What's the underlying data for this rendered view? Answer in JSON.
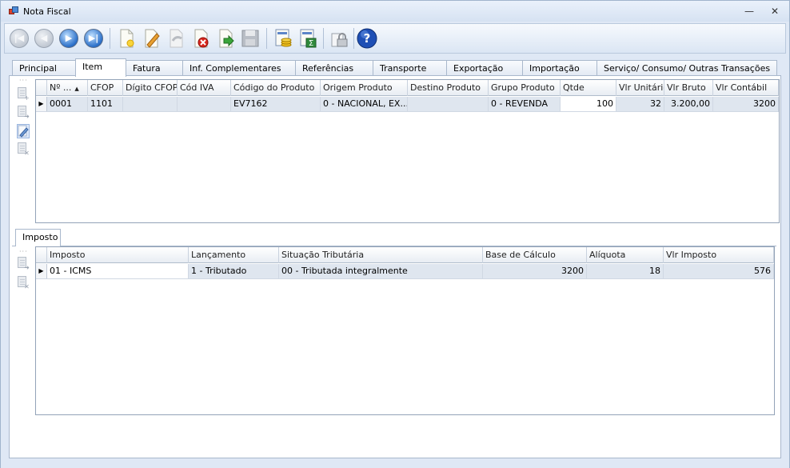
{
  "window": {
    "title": "Nota Fiscal",
    "minimize_glyph": "—",
    "close_glyph": "✕"
  },
  "toolbar": {
    "buttons": [
      {
        "name": "first-record-button",
        "icon": "first-record-icon",
        "enabled": false
      },
      {
        "name": "previous-record-button",
        "icon": "previous-record-icon",
        "enabled": false
      },
      {
        "name": "next-record-button",
        "icon": "next-record-icon",
        "enabled": true
      },
      {
        "name": "last-record-button",
        "icon": "last-record-icon",
        "enabled": true
      },
      {
        "name": "new-button",
        "icon": "new-document-icon",
        "enabled": true
      },
      {
        "name": "edit-button",
        "icon": "pencil-icon",
        "enabled": true
      },
      {
        "name": "undo-button",
        "icon": "undo-icon",
        "enabled": false
      },
      {
        "name": "delete-button",
        "icon": "delete-icon",
        "enabled": true
      },
      {
        "name": "export-button",
        "icon": "export-document-icon",
        "enabled": true
      },
      {
        "name": "save-button",
        "icon": "floppy-disk-icon",
        "enabled": false
      },
      {
        "name": "finance-button",
        "icon": "coins-document-icon",
        "enabled": true
      },
      {
        "name": "calculate-button",
        "icon": "sum-document-icon",
        "enabled": true
      },
      {
        "name": "lock-button",
        "icon": "lock-icon",
        "enabled": true
      },
      {
        "name": "help-button",
        "icon": "help-icon",
        "enabled": true
      }
    ]
  },
  "tabs": [
    {
      "label": "Principal",
      "active": false
    },
    {
      "label": "Item",
      "active": true
    },
    {
      "label": "Fatura",
      "active": false
    },
    {
      "label": "Inf. Complementares",
      "active": false
    },
    {
      "label": "Referências",
      "active": false
    },
    {
      "label": "Transporte",
      "active": false
    },
    {
      "label": "Exportação",
      "active": false
    },
    {
      "label": "Importação",
      "active": false
    },
    {
      "label": "Serviço/ Consumo/ Outras Transações",
      "active": false
    }
  ],
  "items_grid": {
    "columns": [
      "Nº ...",
      "CFOP",
      "Dígito CFOP",
      "Cód IVA",
      "Código do Produto",
      "Origem Produto",
      "Destino Produto",
      "Grupo Produto",
      "Qtde",
      "Vlr Unitário",
      "Vlr Bruto",
      "Vlr Contábil"
    ],
    "rows": [
      [
        "0001",
        "1101",
        "",
        "",
        "EV7162",
        "0 - NACIONAL, EX...",
        "",
        "0 - REVENDA",
        "100",
        "32",
        "3.200,00",
        "3200"
      ]
    ]
  },
  "imposto_tab": {
    "label": "Imposto"
  },
  "imposto_grid": {
    "columns": [
      "Imposto",
      "Lançamento",
      "Situação Tributária",
      "Base de Cálculo",
      "Alíquota",
      "Vlr Imposto"
    ],
    "rows": [
      [
        "01 - ICMS",
        "1 - Tributado",
        "00 - Tributada integralmente",
        "3200",
        "18",
        "576"
      ]
    ]
  },
  "colors": {
    "accent_blue": "#2a6fc9",
    "row_selected": "#dfe6ef",
    "help_blue": "#1e4fb5",
    "delete_red": "#d9261c",
    "edit_orange": "#e8a030",
    "export_green": "#3aa53a"
  }
}
